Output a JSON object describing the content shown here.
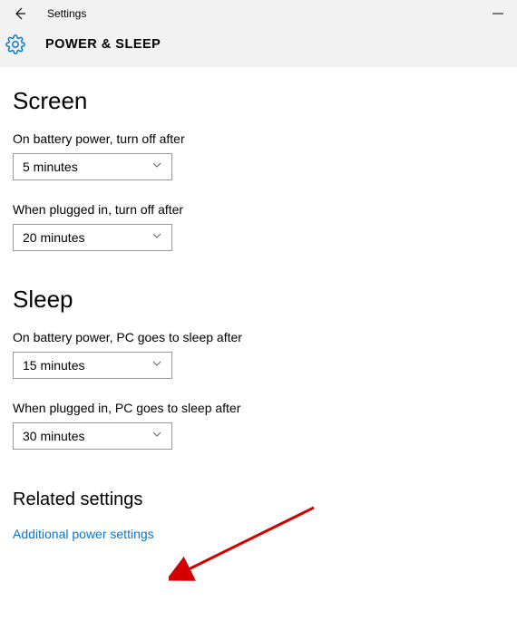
{
  "window": {
    "title": "Settings"
  },
  "page": {
    "title": "POWER & SLEEP"
  },
  "sections": {
    "screen": {
      "heading": "Screen",
      "battery_label": "On battery power, turn off after",
      "battery_value": "5 minutes",
      "plugged_label": "When plugged in, turn off after",
      "plugged_value": "20 minutes"
    },
    "sleep": {
      "heading": "Sleep",
      "battery_label": "On battery power, PC goes to sleep after",
      "battery_value": "15 minutes",
      "plugged_label": "When plugged in, PC goes to sleep after",
      "plugged_value": "30 minutes"
    },
    "related": {
      "heading": "Related settings",
      "link": "Additional power settings"
    }
  }
}
